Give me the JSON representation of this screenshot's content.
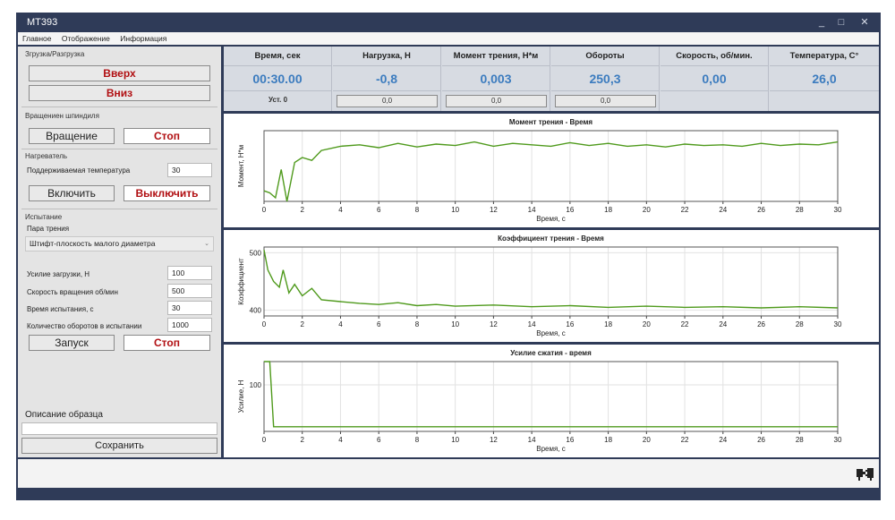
{
  "window": {
    "title": "MT393",
    "min_glyph": "_",
    "max_glyph": "□",
    "close_glyph": "✕"
  },
  "menu": [
    "Главное",
    "Отображение",
    "Информация"
  ],
  "left": {
    "load_group": "Згрузка/Разгрузка",
    "up_button": "Вверх",
    "down_button": "Вниз",
    "spindle_group": "Вращениен шпиндиля",
    "rotate_button": "Вращение",
    "stop_button": "Стоп",
    "heater_group": "Нагреватель",
    "temp_label": "Поддерживаемая температура",
    "temp_value": "30",
    "on_button": "Включить",
    "off_button": "Выключить",
    "test_group": "Испытание",
    "pair_label": "Пара трения",
    "pair_value": "Штифт-плоскость малого диаметра",
    "params": [
      {
        "label": "Усилие загрузки, Н",
        "value": "100"
      },
      {
        "label": "Скорость вращения об/мин",
        "value": "500"
      },
      {
        "label": "Время испытания, с",
        "value": "30"
      },
      {
        "label": "Количество оборотов в испытании",
        "value": "1000"
      }
    ],
    "start_button": "Запуск",
    "stop2_button": "Стоп",
    "desc_label": "Описание образца",
    "desc_value": "",
    "save_button": "Сохранить"
  },
  "table": {
    "columns": [
      {
        "header": "Время, сек",
        "value": "00:30.00",
        "sub": "Уст. 0"
      },
      {
        "header": "Нагрузка, Н",
        "value": "-0,8",
        "sub": "0,0"
      },
      {
        "header": "Момент трения, Н*м",
        "value": "0,003",
        "sub": "0,0"
      },
      {
        "header": "Обороты",
        "value": "250,3",
        "sub": "0,0"
      },
      {
        "header": "Скорость, об/мин.",
        "value": "0,00",
        "sub": ""
      },
      {
        "header": "Температура, C°",
        "value": "26,0",
        "sub": ""
      }
    ]
  },
  "chart_data": [
    {
      "type": "line",
      "title": "Момент трения - Время",
      "xlabel": "Время, с",
      "ylabel": "Момент, Н*м",
      "xlim": [
        0,
        30
      ],
      "xticks": [
        0,
        2,
        4,
        6,
        8,
        10,
        12,
        14,
        16,
        18,
        20,
        22,
        24,
        26,
        28,
        30
      ],
      "yticks": [],
      "ylim": [
        0,
        1
      ],
      "grid": true,
      "color": "#4f9a1c",
      "x": [
        0,
        0.3,
        0.6,
        0.9,
        1.2,
        1.6,
        2.0,
        2.5,
        3,
        4,
        5,
        6,
        7,
        8,
        9,
        10,
        11,
        12,
        13,
        14,
        15,
        16,
        17,
        18,
        19,
        20,
        21,
        22,
        23,
        24,
        25,
        26,
        27,
        28,
        29,
        30
      ],
      "values": [
        0.15,
        0.12,
        0.05,
        0.45,
        0.0,
        0.55,
        0.62,
        0.58,
        0.72,
        0.78,
        0.8,
        0.76,
        0.82,
        0.77,
        0.81,
        0.79,
        0.84,
        0.78,
        0.82,
        0.8,
        0.78,
        0.83,
        0.79,
        0.82,
        0.78,
        0.8,
        0.77,
        0.81,
        0.79,
        0.8,
        0.78,
        0.82,
        0.79,
        0.81,
        0.8,
        0.84
      ]
    },
    {
      "type": "line",
      "title": "Коэффициент трения - Время",
      "xlabel": "Время, с",
      "ylabel": "Коэффициент",
      "xlim": [
        0,
        30
      ],
      "ylim": [
        390,
        510
      ],
      "xticks": [
        0,
        2,
        4,
        6,
        8,
        10,
        12,
        14,
        16,
        18,
        20,
        22,
        24,
        26,
        28,
        30
      ],
      "yticks": [
        400,
        500
      ],
      "grid": true,
      "color": "#4f9a1c",
      "x": [
        0,
        0.2,
        0.5,
        0.8,
        1.0,
        1.3,
        1.6,
        2.0,
        2.5,
        3,
        4,
        5,
        6,
        7,
        8,
        9,
        10,
        12,
        14,
        16,
        18,
        20,
        22,
        24,
        26,
        28,
        30
      ],
      "values": [
        505,
        470,
        450,
        440,
        470,
        430,
        445,
        425,
        438,
        418,
        415,
        412,
        410,
        413,
        408,
        410,
        407,
        409,
        406,
        408,
        405,
        407,
        405,
        406,
        404,
        406,
        404
      ]
    },
    {
      "type": "line",
      "title": "Усилие сжатия - время",
      "xlabel": "Время, с",
      "ylabel": "Усилие, Н",
      "xlim": [
        0,
        30
      ],
      "ylim": [
        0,
        150
      ],
      "xticks": [
        0,
        2,
        4,
        6,
        8,
        10,
        12,
        14,
        16,
        18,
        20,
        22,
        24,
        26,
        28,
        30
      ],
      "yticks": [
        100
      ],
      "grid": true,
      "color": "#4f9a1c",
      "x": [
        0,
        0.3,
        0.5,
        1,
        2,
        4,
        6,
        8,
        10,
        12,
        14,
        16,
        18,
        20,
        22,
        24,
        26,
        28,
        30
      ],
      "values": [
        150,
        150,
        10,
        10,
        10,
        10,
        10,
        10,
        10,
        10,
        10,
        10,
        10,
        10,
        10,
        10,
        10,
        10,
        10
      ]
    }
  ]
}
